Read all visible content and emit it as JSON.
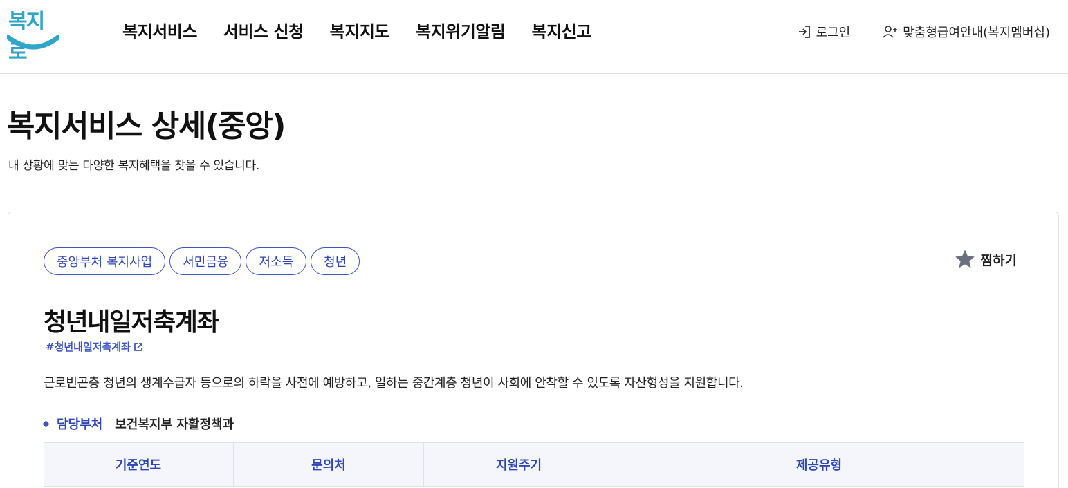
{
  "header": {
    "logo_text": "복지로",
    "nav": [
      "복지서비스",
      "서비스 신청",
      "복지지도",
      "복지위기알림",
      "복지신고"
    ],
    "login_label": "로그인",
    "membership_label": "맞춤형급여안내(복지멤버십)"
  },
  "page": {
    "title": "복지서비스 상세(중앙)",
    "description": "내 상황에 맞는 다양한 복지혜택을 찾을 수 있습니다."
  },
  "service": {
    "tags": [
      "중앙부처 복지사업",
      "서민금융",
      "저소득",
      "청년"
    ],
    "favorite_label": "찜하기",
    "name": "청년내일저축계좌",
    "hashtag": "#청년내일저축계좌",
    "summary": "근로빈곤층 청년의 생계수급자 등으로의 하락을 사전에 예방하고, 일하는 중간계층 청년이 사회에 안착할 수 있도록 자산형성을 지원합니다.",
    "department_label": "담당부처",
    "department_value": "보건복지부 자활정책과",
    "table_headers": [
      "기준연도",
      "문의처",
      "지원주기",
      "제공유형"
    ]
  },
  "colors": {
    "brand": "#2fa6c9",
    "accent": "#3c55c4",
    "table_header_bg": "#f4f6fb"
  },
  "icons": {
    "login": "login-icon",
    "membership": "user-plus-icon",
    "favorite": "star-icon",
    "external": "external-link-icon"
  }
}
